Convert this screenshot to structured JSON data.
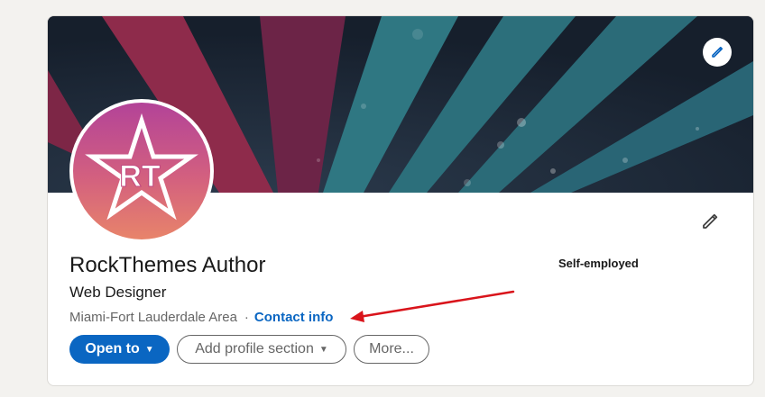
{
  "profile": {
    "name": "RockThemes Author",
    "headline": "Web Designer",
    "location": "Miami-Fort Lauderdale Area",
    "separator": "·",
    "contact_label": "Contact info",
    "current_position": "Self-employed",
    "avatar_initials": "RT"
  },
  "actions": {
    "open_to_label": "Open to",
    "add_section_label": "Add profile section",
    "more_label": "More..."
  },
  "icons": {
    "banner_edit": "pencil-icon",
    "intro_edit": "pencil-icon",
    "caret": "caret-down-icon"
  },
  "colors": {
    "accent": "#0a66c2",
    "annotation": "#d9141b",
    "avatar_gradient_top": "#b34398",
    "avatar_gradient_bottom": "#e8846a"
  }
}
